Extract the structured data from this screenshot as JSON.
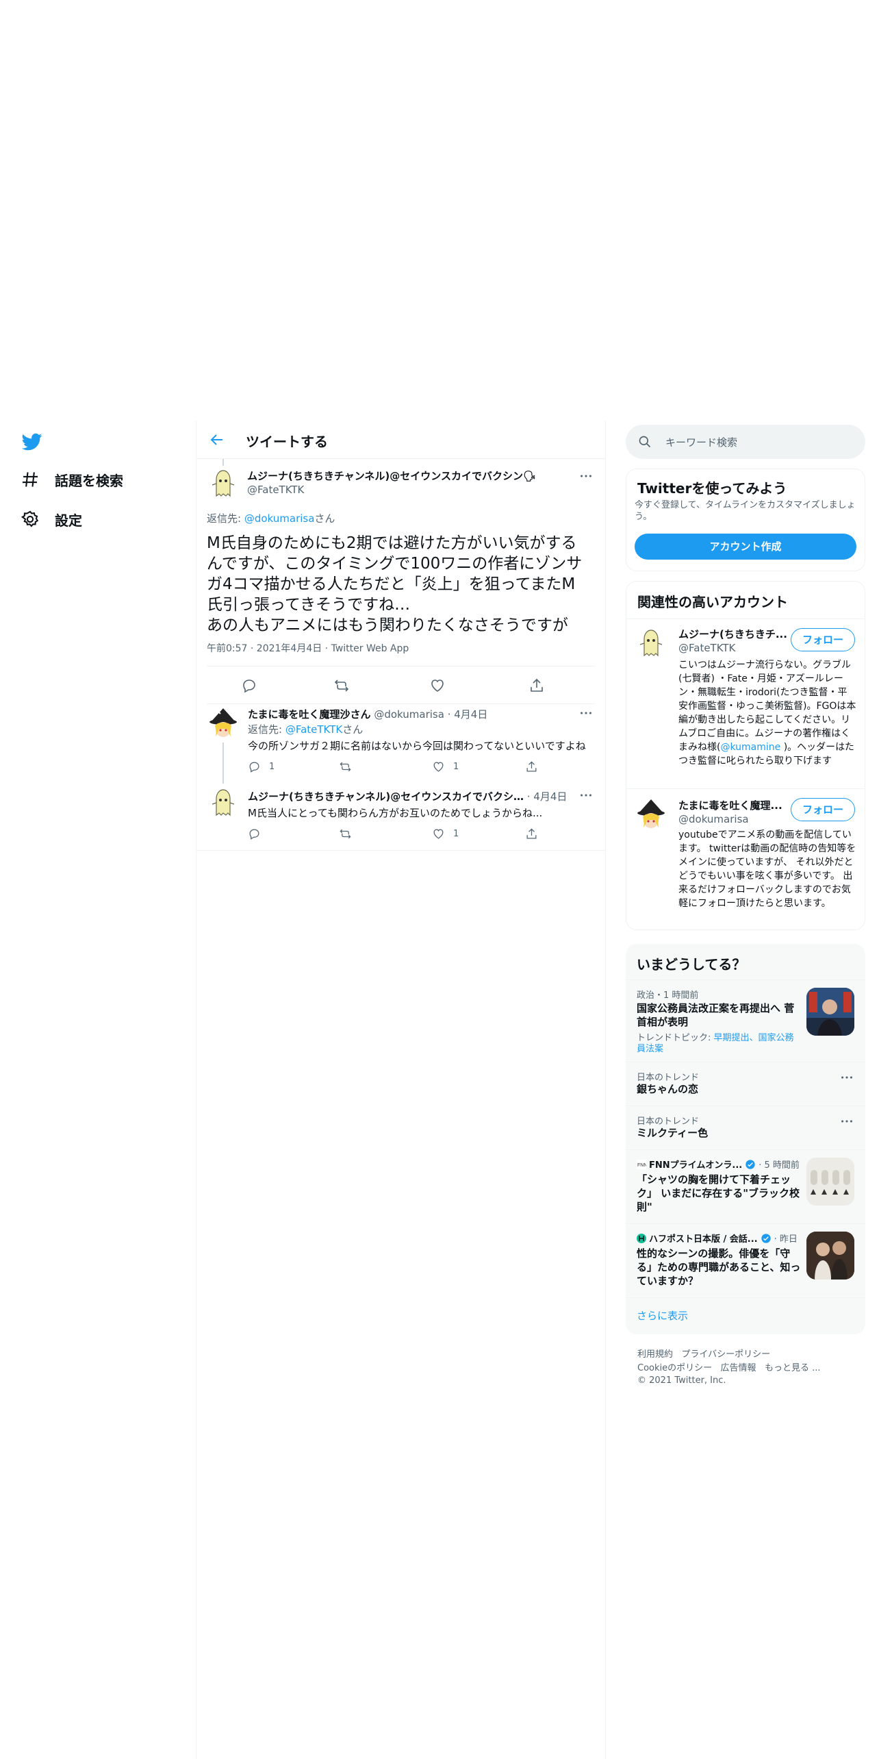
{
  "nav": {
    "items": [
      {
        "label": "話題を検索",
        "icon": "hashtag-icon"
      },
      {
        "label": "設定",
        "icon": "gear-icon"
      }
    ]
  },
  "header": {
    "title": "ツイートする"
  },
  "main_tweet": {
    "name": "ムジーナ(ちきちきチャンネル)@セイウンスカイでバクシン🗣",
    "handle": "@FateTKTK",
    "reply_prefix": "返信先: ",
    "reply_to": "@dokumarisa",
    "reply_suffix": "さん",
    "text": "M氏自身のためにも2期では避けた方がいい気がするんですが、このタイミングで100ワニの作者にゾンサガ4コマ描かせる人たちだと「炎上」を狙ってまたM氏引っ張ってきそうですね…\nあの人もアニメにはもう関わりたくなさそうですが",
    "meta": "午前0:57 · 2021年4月4日 · Twitter Web App"
  },
  "replies": [
    {
      "name": "たまに毒を吐く魔理沙さん",
      "handle": "@dokumarisa",
      "date": "· 4月4日",
      "reply_prefix": "返信先: ",
      "reply_to": "@FateTKTK",
      "reply_suffix": "さん",
      "text": "今の所ゾンサガ２期に名前はないから今回は関わってないといいですよね",
      "reply_count": "1",
      "retweet_count": "",
      "like_count": "1"
    },
    {
      "name": "ムジーナ(ちきちきチャンネル)@セイウンスカイでバクシ…",
      "handle": "",
      "date": "· 4月4日",
      "text": "M氏当人にとっても関わらん方がお互いのためでしょうからね...",
      "reply_count": "",
      "retweet_count": "",
      "like_count": "1"
    }
  ],
  "search": {
    "placeholder": "キーワード検索"
  },
  "signup_card": {
    "title": "Twitterを使ってみよう",
    "description": "今すぐ登録して、タイムラインをカスタマイズしましょう。",
    "button": "アカウント作成"
  },
  "related": {
    "title": "関連性の高いアカウント",
    "accounts": [
      {
        "name": "ムジーナ(ちきちきチ...",
        "handle": "@FateTKTK",
        "follow": "フォロー",
        "bio_before": "こいつはムジーナ流行らない。グラブル(七賢者) ・Fate・月姫・アズールレーン・無職転生・irodori(たつき監督・平安作画監督・ゆっこ美術監督)。FGOは本編が動き出したら起こしてください。リムブロご自由に。ムジーナの著作権はくまみね様(",
        "bio_link": "@kumamine",
        "bio_after": " )。ヘッダーはたつき監督に叱られたら取り下げます"
      },
      {
        "name": "たまに毒を吐く魔理...",
        "handle": "@dokumarisa",
        "follow": "フォロー",
        "bio_before": "youtubeでアニメ系の動画を配信しています。 twitterは動画の配信時の告知等をメインに使っていますが、 それ以外だとどうでもいい事を呟く事が多いです。 出来るだけフォローバックしますのでお気軽にフォロー頂けたらと思います。",
        "bio_link": "",
        "bio_after": ""
      }
    ]
  },
  "trends": {
    "title": "いまどうしてる？",
    "items": [
      {
        "meta": "政治・1 時間前",
        "title": "国家公務員法改正案を再提出へ 菅首相が表明",
        "topics_prefix": "トレンドトピック: ",
        "topics": "早期提出、国家公務員法案"
      },
      {
        "meta": "日本のトレンド",
        "title": "銀ちゃんの恋"
      },
      {
        "meta": "日本のトレンド",
        "title": "ミルクティー色"
      },
      {
        "source": "FNNプライムオンラ...",
        "time": "· 5 時間前",
        "title": "「シャツの胸を開けて下着チェック」 いまだに存在する\"ブラック校則\""
      },
      {
        "source": "ハフポスト日本版 / 会話...",
        "time": "· 昨日",
        "title": "性的なシーンの撮影。俳優を「守る」ための専門職があること、知っていますか？"
      }
    ],
    "show_more": "さらに表示"
  },
  "footer": {
    "links_row1": [
      "利用規約",
      "プライバシーポリシー"
    ],
    "links_row2": [
      "Cookieのポリシー",
      "広告情報",
      "もっと見る ..."
    ],
    "copyright": "© 2021 Twitter, Inc."
  },
  "colors": {
    "accent": "#1d9bf0",
    "text": "#0f1419",
    "muted": "#536471",
    "border": "#eff3f4"
  }
}
